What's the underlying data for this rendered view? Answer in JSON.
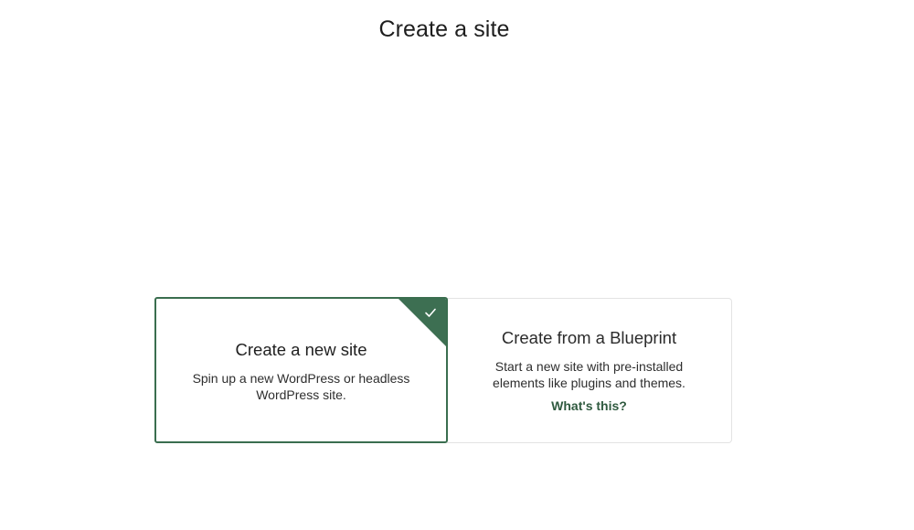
{
  "page": {
    "title": "Create a site"
  },
  "options": {
    "new_site": {
      "title": "Create a new site",
      "description": "Spin up a new WordPress or headless WordPress site.",
      "selected": true
    },
    "blueprint": {
      "title": "Create from a Blueprint",
      "description": "Start a new site with pre-installed elements like plugins and themes.",
      "link_label": "What's this?",
      "selected": false
    }
  },
  "icons": {
    "selected_indicator": "check-icon"
  },
  "colors": {
    "accent": "#3d6f52",
    "link": "#2f5a3f",
    "border_selected": "#3a6e4f",
    "border_unselected": "#e3e3e3"
  }
}
